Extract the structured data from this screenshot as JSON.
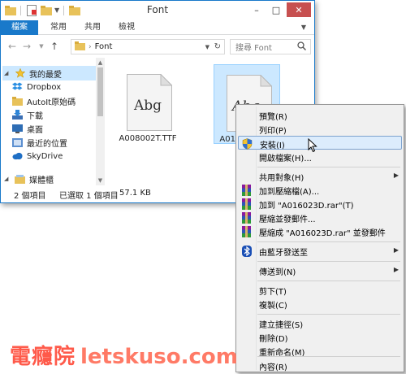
{
  "window": {
    "title": "Font",
    "ribbon_tabs": [
      "檔案",
      "常用",
      "共用",
      "檢視"
    ],
    "address": {
      "folder": "Font"
    },
    "search_placeholder": "搜尋 Font",
    "nav": {
      "favorites": "我的最愛",
      "items": [
        "Dropbox",
        "AutoIt原始碼",
        "下載",
        "桌面",
        "最近的位置",
        "SkyDrive"
      ],
      "libraries": "媒體櫃"
    },
    "files": [
      {
        "preview": "Abg",
        "name": "A008002T.TTF"
      },
      {
        "preview": "Abg",
        "name": "A016023D.ttf"
      }
    ],
    "status": {
      "count": "2 個項目",
      "selected": "已選取 1 個項目",
      "size": "57.1 KB"
    }
  },
  "context_menu": {
    "items": [
      {
        "label": "預覽(R)",
        "icon": "none"
      },
      {
        "label": "列印(P)",
        "icon": "none"
      },
      {
        "label": "安裝(I)",
        "icon": "uac-shield-icon"
      },
      {
        "label": "開啟檔案(H)...",
        "icon": "none"
      },
      {
        "label": "共用對象(H)",
        "icon": "none",
        "submenu": true
      },
      {
        "label": "加到壓縮檔(A)...",
        "icon": "winrar-icon"
      },
      {
        "label": "加到 \"A016023D.rar\"(T)",
        "icon": "winrar-icon"
      },
      {
        "label": "壓縮並發郵件...",
        "icon": "winrar-icon"
      },
      {
        "label": "壓縮成 \"A016023D.rar\" 並發郵件",
        "icon": "winrar-icon"
      },
      {
        "label": "由藍牙發送至",
        "icon": "bluetooth-icon",
        "submenu": true
      },
      {
        "label": "傳送到(N)",
        "icon": "none",
        "submenu": true
      },
      {
        "label": "剪下(T)",
        "icon": "none"
      },
      {
        "label": "複製(C)",
        "icon": "none"
      },
      {
        "label": "建立捷徑(S)",
        "icon": "none"
      },
      {
        "label": "刪除(D)",
        "icon": "none"
      },
      {
        "label": "重新命名(M)",
        "icon": "none"
      },
      {
        "label": "內容(R)",
        "icon": "none"
      }
    ],
    "hovered_index": 2
  },
  "watermark": {
    "cn": "電癮院",
    "en": "letskuso.com"
  },
  "colors": {
    "accent": "#1979ca",
    "selection": "#cce8ff",
    "watermark": "#ff5a4a"
  }
}
